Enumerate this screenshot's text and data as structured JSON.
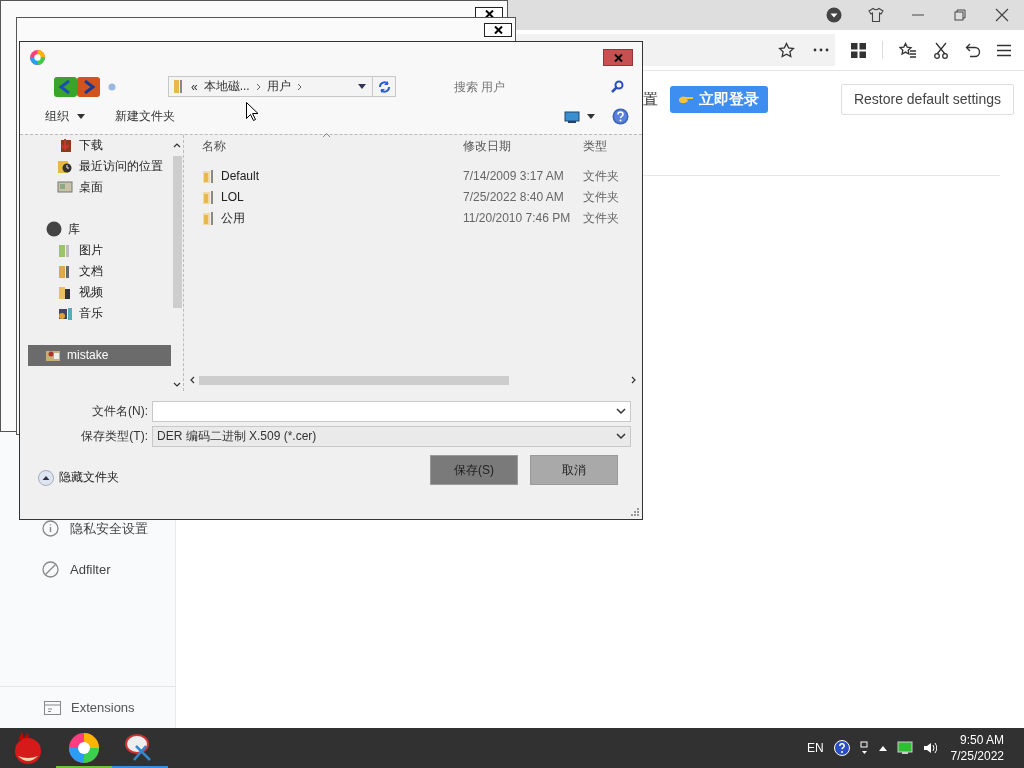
{
  "browser": {
    "heading_fragment": "置",
    "login_button": "立即登录",
    "restore_button": "Restore default settings",
    "sidebar": [
      {
        "label": "隐私安全设置"
      },
      {
        "label": "Adfilter"
      }
    ],
    "footer_item": "Extensions"
  },
  "dialog": {
    "address": {
      "overflow": "«",
      "segments": [
        "本地磁...",
        "用户"
      ]
    },
    "search": {
      "placeholder": "搜索 用户"
    },
    "toolbar": [
      {
        "label": "组织",
        "dropdown": true
      },
      {
        "label": "新建文件夹",
        "dropdown": false
      }
    ],
    "nav": [
      {
        "label": "下载",
        "kind": "folder",
        "selected": false
      },
      {
        "label": "最近访问的位置",
        "kind": "folder",
        "selected": false
      },
      {
        "label": "桌面",
        "kind": "folder",
        "selected": false
      },
      {
        "label": "库",
        "kind": "group",
        "selected": false
      },
      {
        "label": "图片",
        "kind": "folder",
        "selected": false
      },
      {
        "label": "文档",
        "kind": "folder",
        "selected": false
      },
      {
        "label": "视频",
        "kind": "folder",
        "selected": false
      },
      {
        "label": "音乐",
        "kind": "folder",
        "selected": false
      },
      {
        "label": "mistake",
        "kind": "device",
        "selected": true
      }
    ],
    "columns": [
      "名称",
      "修改日期",
      "类型"
    ],
    "rows": [
      {
        "name": "Default",
        "modified": "7/14/2009 3:17 AM",
        "type": "文件夹"
      },
      {
        "name": "LOL",
        "modified": "7/25/2022 8:40 AM",
        "type": "文件夹"
      },
      {
        "name": "公用",
        "modified": "11/20/2010 7:46 PM",
        "type": "文件夹"
      }
    ],
    "file_name": {
      "label": "文件名(N):"
    },
    "save_type": {
      "label": "保存类型(T):",
      "value": "DER 编码二进制 X.509 (*.cer)"
    },
    "hide_folders": "隐藏文件夹",
    "buttons": [
      {
        "label": "保存(S)",
        "kind": "primary"
      },
      {
        "label": "取消",
        "kind": "secondary"
      }
    ]
  },
  "taskbar": {
    "apps": [
      {
        "running": false
      },
      {
        "running": true,
        "color": "#6fbf3a"
      },
      {
        "running": true,
        "color": "#3b8be0"
      }
    ],
    "language": "EN",
    "time": "9:50 AM",
    "date": "7/25/2022"
  }
}
